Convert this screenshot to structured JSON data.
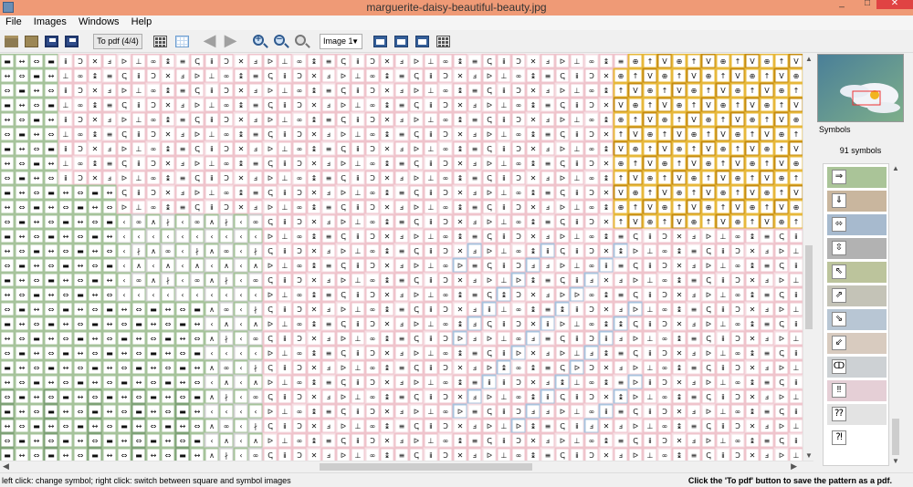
{
  "window": {
    "title": "marguerite-daisy-beautiful-beauty.jpg",
    "min": "_",
    "max": "□",
    "close": "✕"
  },
  "menu": {
    "items": [
      "File",
      "Images",
      "Windows",
      "Help"
    ]
  },
  "toolbar": {
    "to_pdf_label": "To pdf (4/4)",
    "image_select_value": "Image 1",
    "icons": [
      "open-folder-icon",
      "open-folder-2-icon",
      "save-icon",
      "save-as-icon",
      "grid-dark-icon",
      "grid-light-icon",
      "arrow-left-icon",
      "arrow-right-icon",
      "zoom-in-icon",
      "zoom-out-icon",
      "zoom-reset-icon",
      "image-view-1-icon",
      "image-view-2-icon",
      "image-view-3-icon",
      "image-view-4-icon"
    ]
  },
  "panel": {
    "symbols_label": "Symbols",
    "count_label": "91 symbols",
    "symbols": [
      {
        "glyph": "⇒",
        "color": "#aac498"
      },
      {
        "glyph": "⇓",
        "color": "#c9b69e"
      },
      {
        "glyph": "⬄",
        "color": "#a7bace"
      },
      {
        "glyph": "⇳",
        "color": "#b2b2b2"
      },
      {
        "glyph": "⇖",
        "color": "#bcc49c"
      },
      {
        "glyph": "⇗",
        "color": "#c4c3b7"
      },
      {
        "glyph": "⇘",
        "color": "#b8c6d4"
      },
      {
        "glyph": "⇙",
        "color": "#d8cbbf"
      },
      {
        "glyph": "ↀ",
        "color": "#cdd1d4"
      },
      {
        "glyph": "‼",
        "color": "#e5cfd6"
      },
      {
        "glyph": "⁇",
        "color": "#e3e3e3"
      },
      {
        "glyph": "⁈",
        "color": "#ffffff"
      }
    ]
  },
  "pattern": {
    "glyphs": [
      "▬",
      "↔",
      "⇔",
      "‹",
      "∤",
      "∧",
      "∞",
      "ⅎ",
      "ⅱ",
      "↨",
      "ᐅ",
      "Ↄ",
      "≡",
      "⊥",
      "✕",
      "ↅ",
      "Ⅴ",
      "⊕",
      "↑",
      "↓",
      "ↆ",
      "ⅴ",
      "↯",
      "⊿"
    ],
    "colors": {
      "green": "#a6c39b",
      "dark_green": "#7ea276",
      "pink": "#efc4cc",
      "light_pink": "#f5dde2",
      "gray": "#cfcfcf",
      "blue": "#a9c3de",
      "yellow": "#e7b83b",
      "dark_yellow": "#c68d12"
    }
  },
  "status": {
    "left": "left click: change symbol; right click: switch between square and symbol images",
    "right": "Click the 'To pdf' button to save the pattern as a pdf."
  }
}
